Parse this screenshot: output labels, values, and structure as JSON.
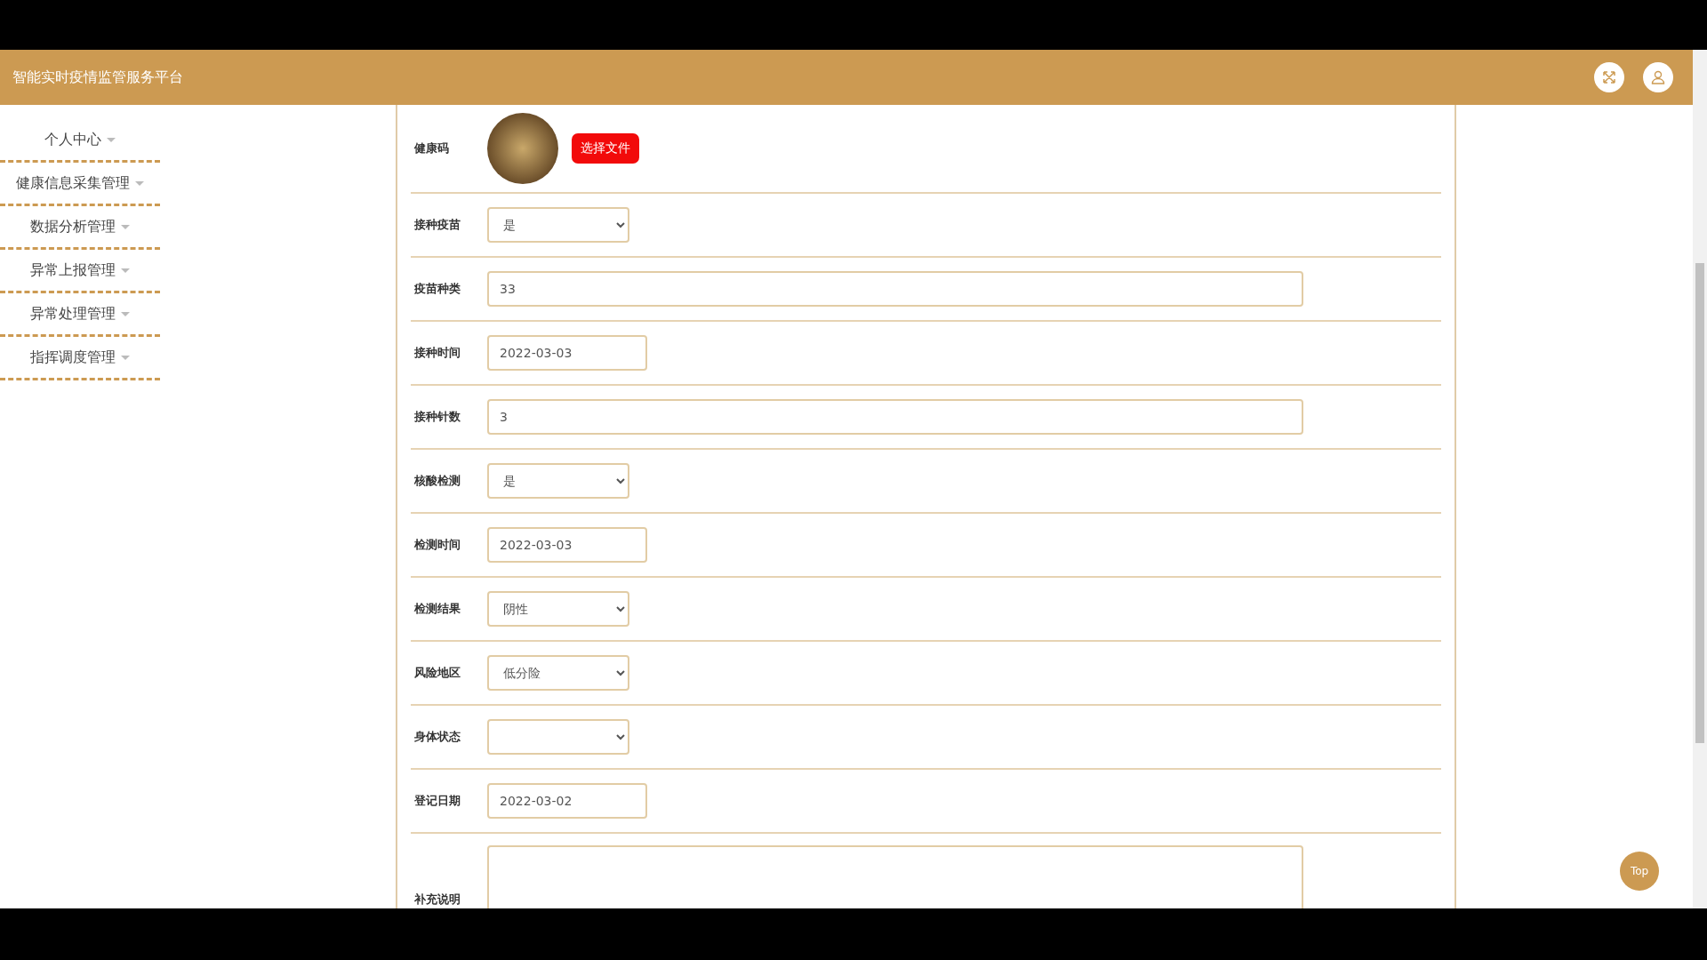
{
  "header": {
    "title": "智能实时疫情监管服务平台"
  },
  "sidebar": {
    "items": [
      {
        "label": "个人中心"
      },
      {
        "label": "健康信息采集管理"
      },
      {
        "label": "数据分析管理"
      },
      {
        "label": "异常上报管理"
      },
      {
        "label": "异常处理管理"
      },
      {
        "label": "指挥调度管理"
      }
    ]
  },
  "form": {
    "fields": [
      {
        "kind": "image",
        "label": "健康码",
        "button": "选择文件"
      },
      {
        "kind": "select",
        "label": "接种疫苗",
        "value": "是"
      },
      {
        "kind": "text",
        "label": "疫苗种类",
        "value": "33"
      },
      {
        "kind": "date",
        "label": "接种时间",
        "value": "2022-03-03"
      },
      {
        "kind": "text",
        "label": "接种针数",
        "value": "3"
      },
      {
        "kind": "select",
        "label": "核酸检测",
        "value": "是"
      },
      {
        "kind": "date",
        "label": "检测时间",
        "value": "2022-03-03"
      },
      {
        "kind": "select",
        "label": "检测结果",
        "value": "阴性"
      },
      {
        "kind": "select",
        "label": "风险地区",
        "value": "低分险"
      },
      {
        "kind": "select",
        "label": "身体状态"
      },
      {
        "kind": "date",
        "label": "登记日期",
        "value": "2022-03-02"
      },
      {
        "kind": "textarea",
        "label": "补充说明"
      }
    ]
  },
  "top_button": {
    "label": "Top"
  }
}
